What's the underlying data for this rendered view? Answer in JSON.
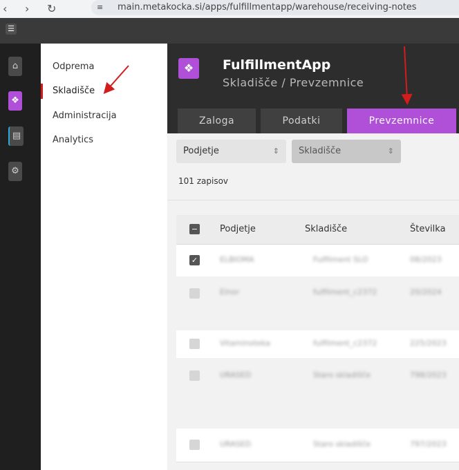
{
  "browser": {
    "url": "main.metakocka.si/apps/fulfillmentapp/warehouse/receiving-notes"
  },
  "app": {
    "title": "FulfillmentApp",
    "subtitle": "Skladišče / Prevzemnice"
  },
  "side_nav": {
    "items": [
      {
        "label": "Odprema"
      },
      {
        "label": "Skladišče"
      },
      {
        "label": "Administracija"
      },
      {
        "label": "Analytics"
      }
    ]
  },
  "tabs": [
    {
      "label": "Zaloga"
    },
    {
      "label": "Podatki"
    },
    {
      "label": "Prevzemnice"
    }
  ],
  "filters": {
    "company_placeholder": "Podjetje",
    "warehouse_placeholder": "Skladišče"
  },
  "record_count": "101 zapisov",
  "table": {
    "columns": [
      "Podjetje",
      "Skladišče",
      "Številka"
    ],
    "rows": [
      {
        "company": "ELBIOMA",
        "warehouse": "Fulfilment SLO",
        "number": "08/2023"
      },
      {
        "company": "Elnor",
        "warehouse": "fulfilment_c2372",
        "number": "20/2024"
      },
      {
        "company": "Vitaminoteka",
        "warehouse": "fulfilment_c2372",
        "number": "225/2023"
      },
      {
        "company": "URASED",
        "warehouse": "Staro skladišče",
        "number": "798/2023"
      },
      {
        "company": "URASED",
        "warehouse": "Staro skladišče",
        "number": "797/2023"
      }
    ]
  },
  "colors": {
    "accent": "#b04fd8",
    "annotation": "#d21d1d"
  }
}
